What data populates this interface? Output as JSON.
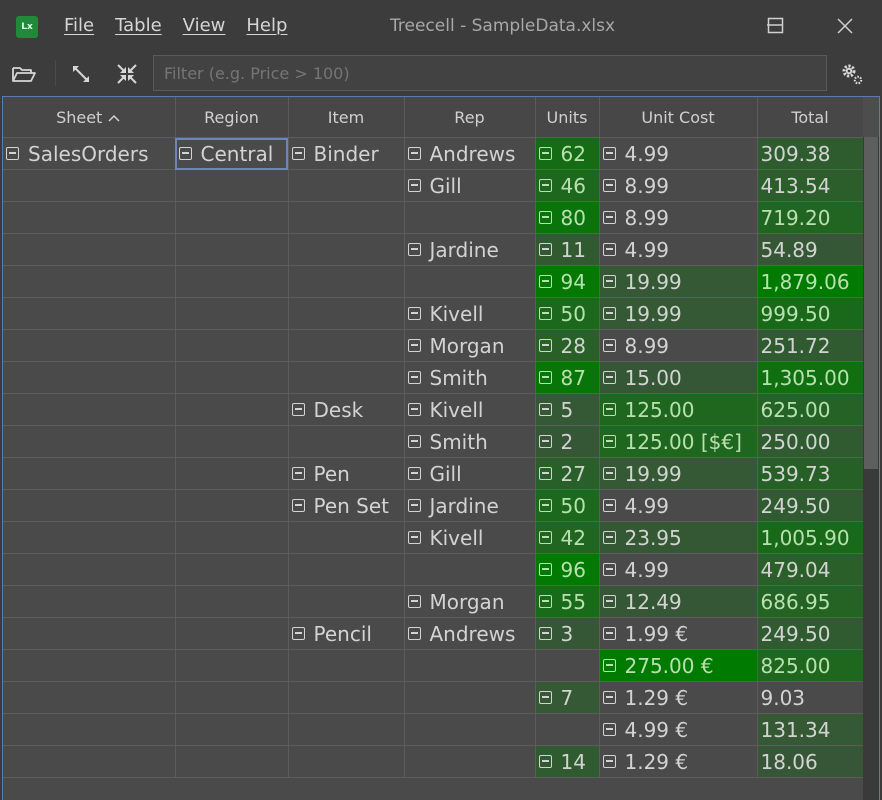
{
  "window": {
    "app_icon": "treecell-app-icon",
    "title": "Treecell - SampleData.xlsx",
    "menu": [
      "File",
      "Table",
      "View",
      "Help"
    ],
    "controls": [
      "minimize",
      "maximize",
      "close"
    ]
  },
  "toolbar": {
    "icons": [
      "open-folder-icon",
      "expand-all-icon",
      "collapse-all-icon",
      "settings-gears-icon"
    ],
    "filter_placeholder": "Filter (e.g. Price > 100)",
    "filter_value": ""
  },
  "colors": {
    "heat_low": "#4a4a4a",
    "heat_high": "#007a00",
    "selection": "#6d86b7"
  },
  "scrollbar": {
    "position_fraction": 0.0,
    "visible_fraction": 0.5
  },
  "table": {
    "columns": [
      {
        "label": "Sheet",
        "sort": "ascending"
      },
      {
        "label": "Region"
      },
      {
        "label": "Item"
      },
      {
        "label": "Rep"
      },
      {
        "label": "Units"
      },
      {
        "label": "Unit Cost"
      },
      {
        "label": "Total"
      }
    ],
    "rows": [
      {
        "sheet": "SalesOrders",
        "region": "Central",
        "item": "Binder",
        "rep": "Andrews",
        "units": "62",
        "units_heat": 0.62,
        "cost": "4.99",
        "cost_heat": 0.0,
        "total": "309.38",
        "total_heat": 0.16
      },
      {
        "sheet": "",
        "region": "",
        "item": "",
        "rep": "Gill",
        "units": "46",
        "units_heat": 0.46,
        "cost": "8.99",
        "cost_heat": 0.0,
        "total": "413.54",
        "total_heat": 0.22
      },
      {
        "sheet": "",
        "region": "",
        "item": "",
        "rep": "",
        "units": "80",
        "units_heat": 0.8,
        "cost": "8.99",
        "cost_heat": 0.0,
        "total": "719.20",
        "total_heat": 0.38
      },
      {
        "sheet": "",
        "region": "",
        "item": "",
        "rep": "Jardine",
        "units": "11",
        "units_heat": 0.11,
        "cost": "4.99",
        "cost_heat": 0.0,
        "total": "54.89",
        "total_heat": 0.03
      },
      {
        "sheet": "",
        "region": "",
        "item": "",
        "rep": "",
        "units": "94",
        "units_heat": 0.94,
        "cost": "19.99",
        "cost_heat": 0.05,
        "total": "1,879.06",
        "total_heat": 1.0
      },
      {
        "sheet": "",
        "region": "",
        "item": "",
        "rep": "Kivell",
        "units": "50",
        "units_heat": 0.5,
        "cost": "19.99",
        "cost_heat": 0.05,
        "total": "999.50",
        "total_heat": 0.53
      },
      {
        "sheet": "",
        "region": "",
        "item": "",
        "rep": "Morgan",
        "units": "28",
        "units_heat": 0.28,
        "cost": "8.99",
        "cost_heat": 0.0,
        "total": "251.72",
        "total_heat": 0.13
      },
      {
        "sheet": "",
        "region": "",
        "item": "",
        "rep": "Smith",
        "units": "87",
        "units_heat": 0.87,
        "cost": "15.00",
        "cost_heat": 0.04,
        "total": "1,305.00",
        "total_heat": 0.69
      },
      {
        "sheet": "",
        "region": "",
        "item": "Desk",
        "rep": "Kivell",
        "units": "5",
        "units_heat": 0.05,
        "cost": "125.00",
        "cost_heat": 0.45,
        "total": "625.00",
        "total_heat": 0.33
      },
      {
        "sheet": "",
        "region": "",
        "item": "",
        "rep": "Smith",
        "units": "2",
        "units_heat": 0.02,
        "cost": "125.00 [$€]",
        "cost_heat": 0.45,
        "total": "250.00",
        "total_heat": 0.13
      },
      {
        "sheet": "",
        "region": "",
        "item": "Pen",
        "rep": "Gill",
        "units": "27",
        "units_heat": 0.27,
        "cost": "19.99",
        "cost_heat": 0.05,
        "total": "539.73",
        "total_heat": 0.29
      },
      {
        "sheet": "",
        "region": "",
        "item": "Pen Set",
        "rep": "Jardine",
        "units": "50",
        "units_heat": 0.5,
        "cost": "4.99",
        "cost_heat": 0.0,
        "total": "249.50",
        "total_heat": 0.13
      },
      {
        "sheet": "",
        "region": "",
        "item": "",
        "rep": "Kivell",
        "units": "42",
        "units_heat": 0.42,
        "cost": "23.95",
        "cost_heat": 0.06,
        "total": "1,005.90",
        "total_heat": 0.53
      },
      {
        "sheet": "",
        "region": "",
        "item": "",
        "rep": "",
        "units": "96",
        "units_heat": 0.96,
        "cost": "4.99",
        "cost_heat": 0.0,
        "total": "479.04",
        "total_heat": 0.25
      },
      {
        "sheet": "",
        "region": "",
        "item": "",
        "rep": "Morgan",
        "units": "55",
        "units_heat": 0.55,
        "cost": "12.49",
        "cost_heat": 0.03,
        "total": "686.95",
        "total_heat": 0.36
      },
      {
        "sheet": "",
        "region": "",
        "item": "Pencil",
        "rep": "Andrews",
        "units": "3",
        "units_heat": 0.03,
        "cost": "1.99 €",
        "cost_heat": 0.0,
        "total": "249.50",
        "total_heat": 0.13
      },
      {
        "sheet": "",
        "region": "",
        "item": "",
        "rep": "",
        "units": "",
        "units_heat": 0.0,
        "cost": "275.00 €",
        "cost_heat": 1.0,
        "total": "825.00",
        "total_heat": 0.44
      },
      {
        "sheet": "",
        "region": "",
        "item": "",
        "rep": "",
        "units": "7",
        "units_heat": 0.07,
        "cost": "1.29 €",
        "cost_heat": 0.0,
        "total": "9.03",
        "total_heat": 0.0
      },
      {
        "sheet": "",
        "region": "",
        "item": "",
        "rep": "",
        "units": "",
        "units_heat": 0.0,
        "cost": "4.99 €",
        "cost_heat": 0.0,
        "total": "131.34",
        "total_heat": 0.07
      },
      {
        "sheet": "",
        "region": "",
        "item": "",
        "rep": "",
        "units": "14",
        "units_heat": 0.14,
        "cost": "1.29 €",
        "cost_heat": 0.0,
        "total": "18.06",
        "total_heat": 0.01
      }
    ],
    "selected_cell": {
      "row": 0,
      "column": "region"
    }
  }
}
